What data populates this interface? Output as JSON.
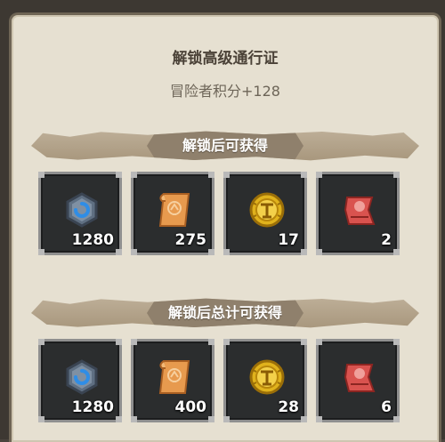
{
  "header": {
    "title": "解锁高级通行证",
    "subtitle": "冒险者积分+128"
  },
  "sections": [
    {
      "label": "解锁后可获得",
      "items": [
        {
          "icon": "blue-gem-hexagon-icon",
          "qty": "1280"
        },
        {
          "icon": "orange-scroll-icon",
          "qty": "275"
        },
        {
          "icon": "gold-coin-icon",
          "qty": "17"
        },
        {
          "icon": "red-cloth-icon",
          "qty": "2"
        }
      ]
    },
    {
      "label": "解锁后总计可获得",
      "items": [
        {
          "icon": "blue-gem-hexagon-icon",
          "qty": "1280"
        },
        {
          "icon": "orange-scroll-icon",
          "qty": "400"
        },
        {
          "icon": "gold-coin-icon",
          "qty": "28"
        },
        {
          "icon": "red-cloth-icon",
          "qty": "6"
        }
      ]
    }
  ]
}
